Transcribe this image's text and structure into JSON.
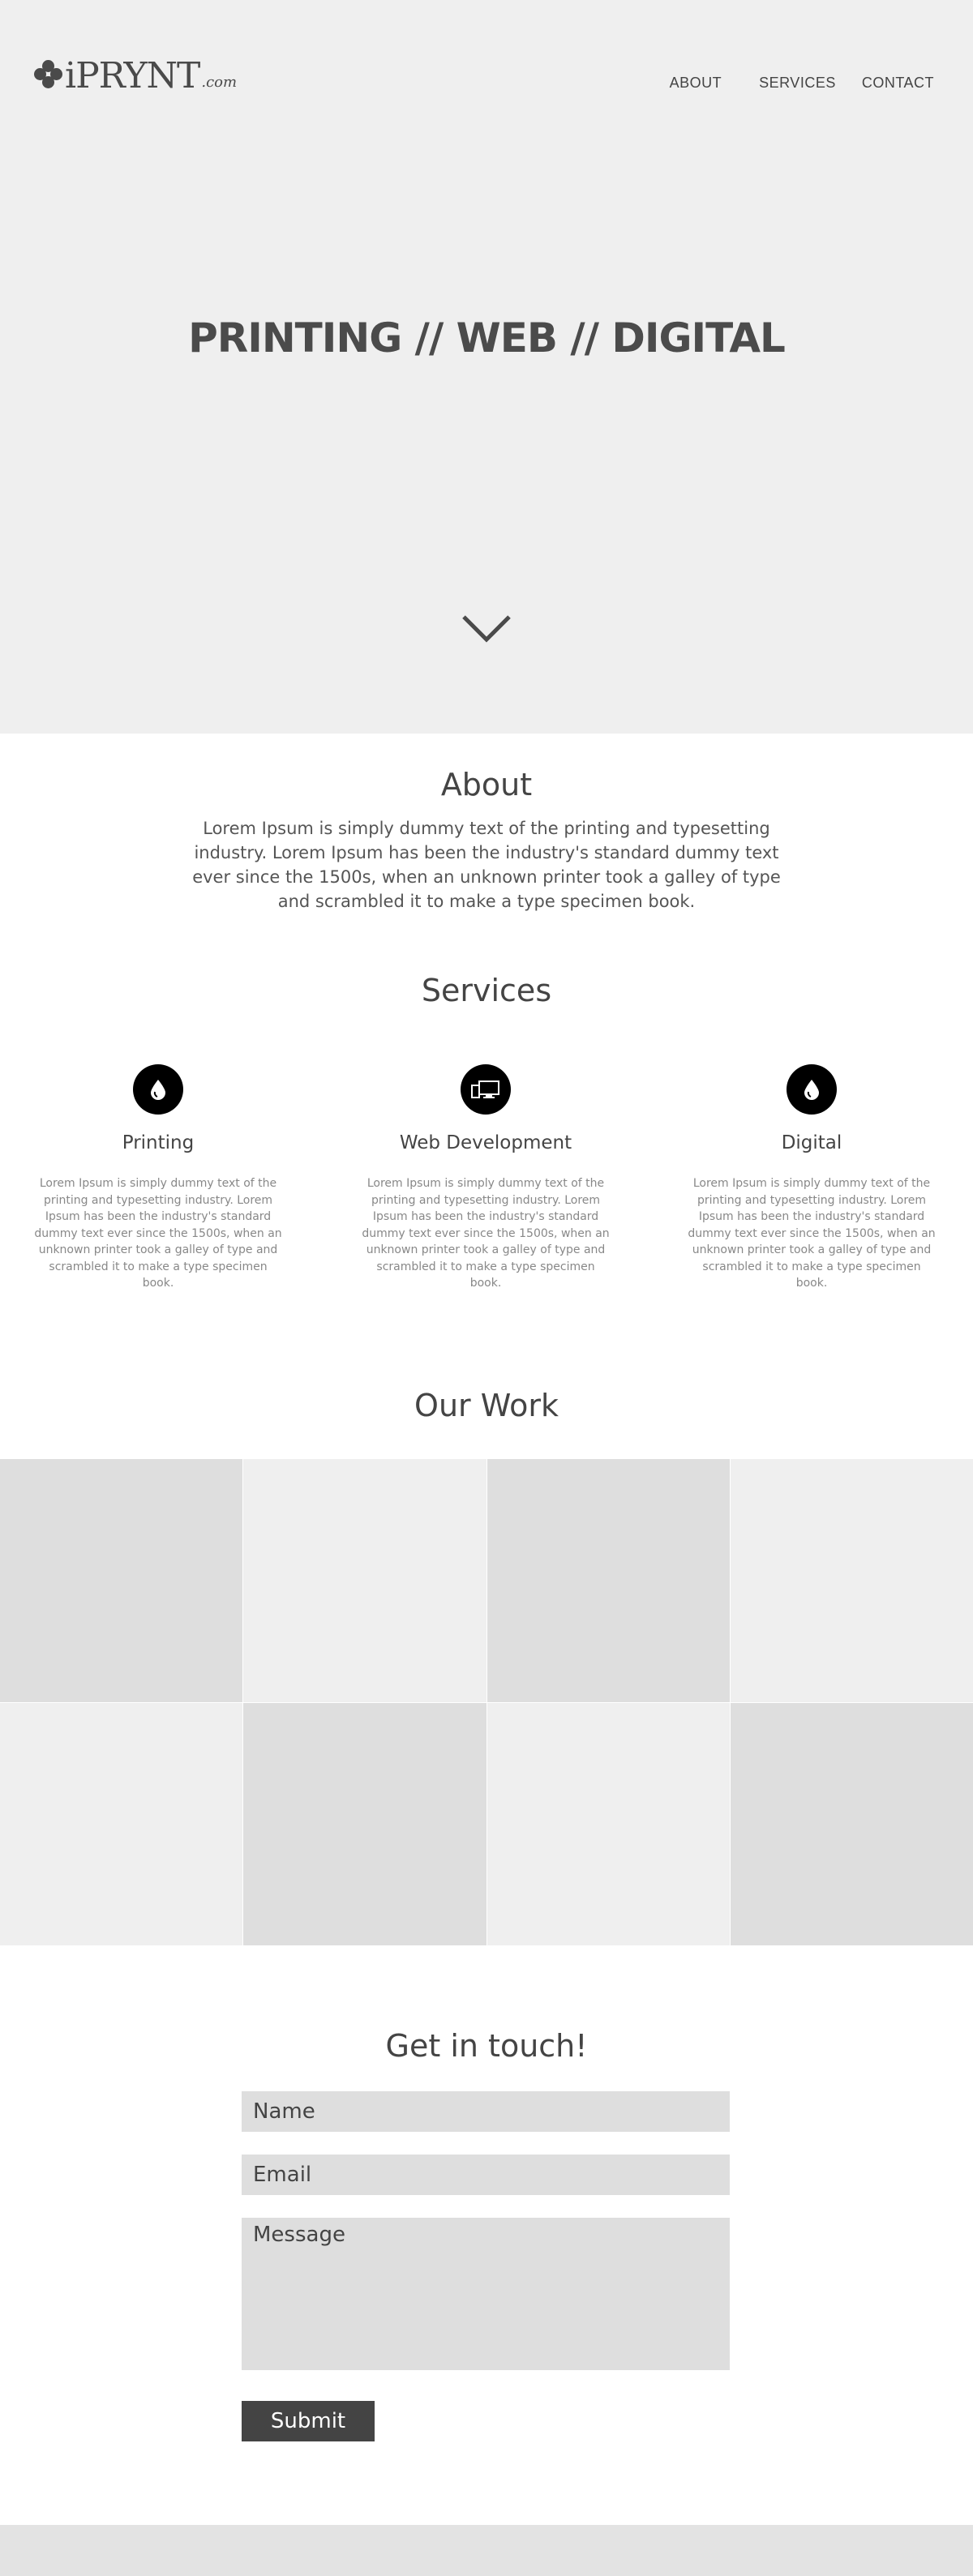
{
  "brand": {
    "name": "iPRYNT",
    "suffix": ".com"
  },
  "nav": {
    "about": "ABOUT",
    "services": "SERVICES",
    "contact": "CONTACT"
  },
  "hero": {
    "title": "PRINTING // WEB // DIGITAL",
    "scroll_icon": "chevron-down-icon"
  },
  "about": {
    "title": "About",
    "text": "Lorem Ipsum is simply dummy text of the printing and typesetting industry. Lorem Ipsum has been the industry's standard dummy text ever since the 1500s, when an unknown printer took a galley of type and scrambled it to make a type specimen book."
  },
  "services": {
    "title": "Services",
    "items": [
      {
        "icon": "ink-drop-icon",
        "name": "Printing",
        "text": "Lorem Ipsum is simply dummy text of the printing and typesetting industry. Lorem Ipsum has been the industry's standard dummy text ever since the 1500s, when an unknown printer took a galley of type and scrambled it to make a type specimen book."
      },
      {
        "icon": "devices-icon",
        "name": "Web Development",
        "text": "Lorem Ipsum is simply dummy text of the printing and typesetting industry. Lorem Ipsum has been the industry's standard dummy text ever since the 1500s, when an unknown printer took a galley of type and scrambled it to make a type specimen book."
      },
      {
        "icon": "ink-drop-icon",
        "name": "Digital",
        "text": "Lorem Ipsum is simply dummy text of the printing and typesetting industry. Lorem Ipsum has been the industry's standard dummy text ever since the 1500s, when an unknown printer took a galley of type and scrambled it to make a type specimen book."
      }
    ]
  },
  "work": {
    "title": "Our Work",
    "tile_colors": [
      "#dedede",
      "#efefef"
    ]
  },
  "contact": {
    "title": "Get in touch!",
    "name_placeholder": "Name",
    "email_placeholder": "Email",
    "message_placeholder": "Message",
    "submit_label": "Submit"
  },
  "colors": {
    "hero_bg": "#efefef",
    "field_bg": "#dedede",
    "button_bg": "#444444",
    "icon_bg": "#000000"
  }
}
